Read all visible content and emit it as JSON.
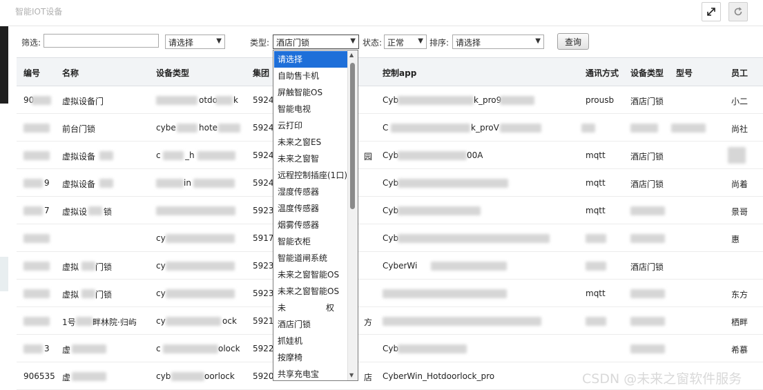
{
  "header": {
    "title": "智能IOT设备"
  },
  "filters": {
    "filter_label": "筛选:",
    "filter_value": "",
    "select1_value": "请选择",
    "type_label": "类型:",
    "type_value": "酒店门锁",
    "status_label": "状态:",
    "status_value": "正常",
    "sort_label": "排序:",
    "sort_value": "请选择",
    "query_label": "查询"
  },
  "table": {
    "columns": [
      "编号",
      "名称",
      "设备类型",
      "集团",
      "控制app",
      "通讯方式",
      "设备类型",
      "型号",
      "员工"
    ],
    "rows": [
      {
        "id": "90",
        "name": "虚拟设备门",
        "devtype": "otdo",
        "devtype2": "k",
        "group": "5924",
        "app": "Cyb",
        "app2": "k_pro9",
        "comm": "prousb",
        "type2": "酒店门锁",
        "model": "",
        "staff": "小二"
      },
      {
        "id": "",
        "name": "前台门锁",
        "devtype": "cybe",
        "devtype2": "hote",
        "group": "5924",
        "app": "C",
        "app2": "k_proV",
        "comm": "",
        "type2": "",
        "model": "",
        "staff": "尚社"
      },
      {
        "id": "",
        "name": "虚拟设备",
        "devtype": "c",
        "devtype2": "_h",
        "group": "5924",
        "app": "Cyb",
        "app2": "00A",
        "comm": "mqtt",
        "type2": "酒店门锁",
        "model": "",
        "staff": ""
      },
      {
        "id": "9",
        "name": "虚拟设备",
        "devtype": "",
        "devtype2": "in",
        "group": "5924",
        "app": "Cyb",
        "app2": "",
        "comm": "mqtt",
        "type2": "酒店门锁",
        "model": "",
        "staff": "尚着"
      },
      {
        "id": "7",
        "name": "虚拟设",
        "devtype": "",
        "devtype2": "锁",
        "group": "5923",
        "app": "Cyb",
        "app2": "",
        "comm": "mqtt",
        "type2": "",
        "model": "",
        "staff": "景哥"
      },
      {
        "id": "",
        "name": "",
        "devtype": "cy",
        "devtype2": "",
        "group": "5917",
        "app": "Cyb",
        "app2": "",
        "comm": "",
        "type2": "",
        "model": "",
        "staff": "惠"
      },
      {
        "id": "",
        "name": "虚拟",
        "devtype": "cy",
        "devtype2": "门锁",
        "group": "5923",
        "app": "CyberWi",
        "app2": "",
        "comm": "",
        "type2": "酒店门锁",
        "model": "",
        "staff": ""
      },
      {
        "id": "",
        "name": "虚拟",
        "devtype": "cy",
        "devtype2": "门锁",
        "group": "5923",
        "app": "",
        "app2": "",
        "comm": "mqtt",
        "type2": "",
        "model": "",
        "staff": "东方"
      },
      {
        "id": "",
        "name": "1号",
        "devtype": "cy",
        "devtype2": "ock",
        "group": "5921",
        "app": "",
        "app2": "",
        "comm": "",
        "type2": "",
        "model": "",
        "staff": "栖畔"
      },
      {
        "id": "3",
        "name": "虚",
        "devtype": "c",
        "devtype2": "olock",
        "group": "5922",
        "app": "Cyb",
        "app2": "",
        "comm": "",
        "type2": "",
        "model": "",
        "staff": "希慕"
      },
      {
        "id": "906535",
        "name": "虚",
        "devtype": "cyb",
        "devtype2": "oorlock",
        "group": "5920",
        "app": "CyberWin_Hotdoorlock_pro",
        "app2": "",
        "comm": "",
        "type2": "",
        "model": "",
        "staff": ""
      }
    ],
    "row9_name_extra": "畔林院·归屿",
    "row9_group_extra": "方",
    "row11_group_extra": "店"
  },
  "dropdown": {
    "options": [
      "请选择",
      "自助售卡机",
      "屏触智能OS",
      "智能电视",
      "云打印",
      "未来之窗ES",
      "未来之窗智",
      "远程控制插座(1口)",
      "湿度传感器",
      "温度传感器",
      "烟雾传感器",
      "智能衣柜",
      "智能道闸系统",
      "未来之窗智能OS",
      "未来之窗智能OS",
      "未",
      "酒店门锁",
      "抓娃机",
      "按摩椅",
      "共享充电宝"
    ],
    "option16_suffix": "权",
    "row3_group_suffix": "园",
    "selected_index": 0
  },
  "watermark": "CSDN @未来之窗软件服务",
  "colors": {
    "selected": "#1e6fd9",
    "header_bg": "#f2f4f6"
  }
}
